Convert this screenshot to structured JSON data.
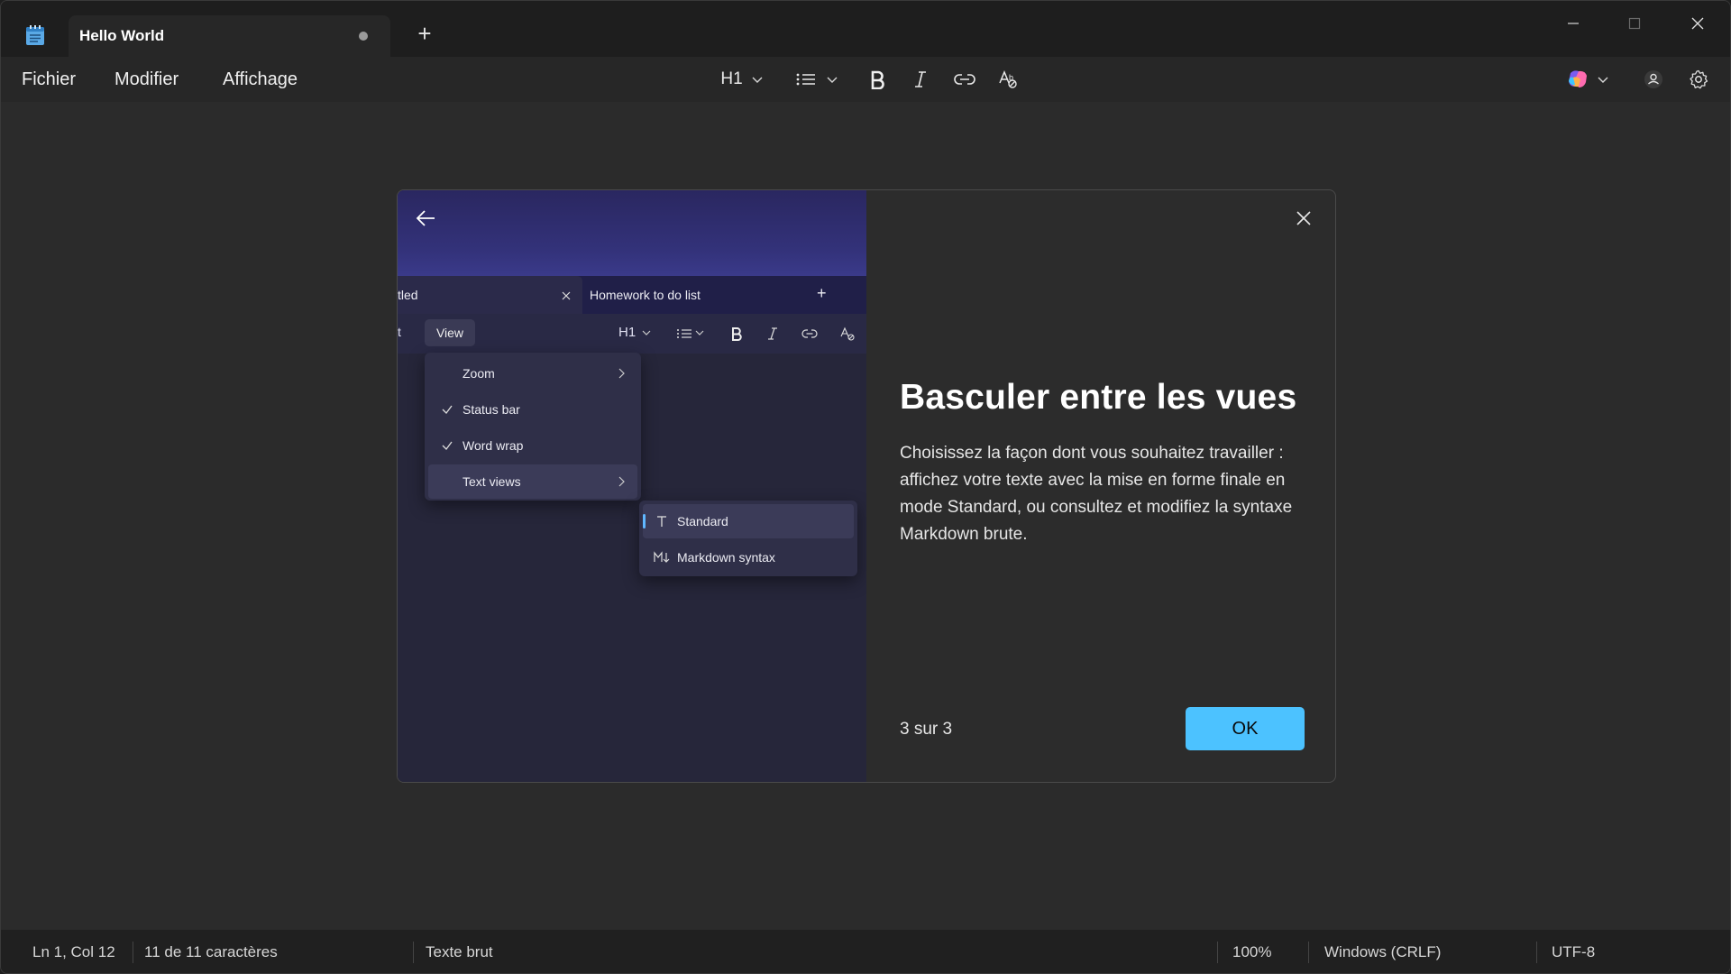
{
  "window": {
    "tab_title": "Hello World",
    "new_tab": "+"
  },
  "menu": {
    "file": "Fichier",
    "edit": "Modifier",
    "view": "Affichage"
  },
  "toolbar": {
    "heading": "H1"
  },
  "dialog": {
    "title": "Basculer entre les vues",
    "body": "Choisissez la façon dont vous souhaitez travailler : affichez votre texte avec la mise en forme finale en mode Standard, ou consultez et modifiez la syntaxe Markdown brute.",
    "step": "3 sur 3",
    "ok_label": "OK",
    "preview": {
      "tab1": "tled",
      "tab2": "Homework to do list",
      "menu_partial": "t",
      "view_button": "View",
      "heading": "H1",
      "menu_items": [
        {
          "label": "Zoom",
          "checked": false,
          "submenu": true
        },
        {
          "label": "Status bar",
          "checked": true,
          "submenu": false
        },
        {
          "label": "Word wrap",
          "checked": true,
          "submenu": false
        },
        {
          "label": "Text views",
          "checked": false,
          "submenu": true
        }
      ],
      "submenu_items": [
        {
          "label": "Standard",
          "icon": "text-t-icon",
          "selected": true
        },
        {
          "label": "Markdown syntax",
          "icon": "markdown-icon",
          "selected": false
        }
      ]
    }
  },
  "status": {
    "position": "Ln 1, Col 12",
    "chars": "11 de 11 caractères",
    "format": "Texte brut",
    "zoom": "100%",
    "line_ending": "Windows (CRLF)",
    "encoding": "UTF-8"
  },
  "colors": {
    "accent": "#4cc2ff",
    "background": "#272727",
    "dialog_bg": "#2c2c2c",
    "preview_gradient": "#33327a"
  }
}
